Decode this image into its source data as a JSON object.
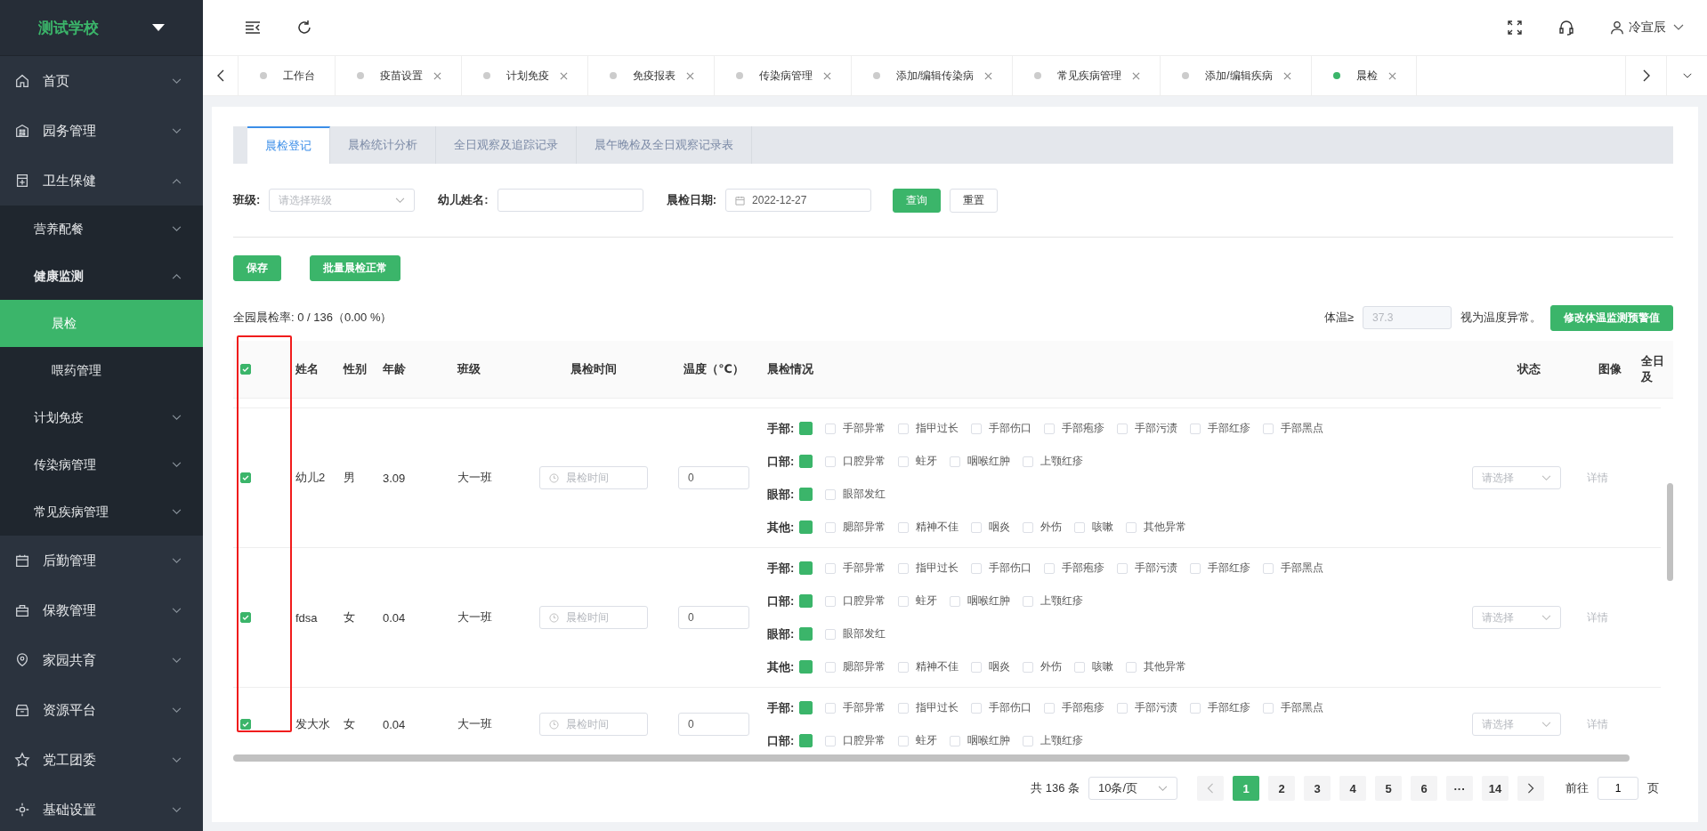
{
  "sidebar": {
    "school": "测试学校",
    "items": [
      {
        "label": "首页",
        "expanded": false
      },
      {
        "label": "园务管理",
        "expanded": false
      },
      {
        "label": "卫生保健",
        "expanded": true,
        "children": [
          {
            "label": "营养配餐",
            "expanded": false
          },
          {
            "label": "健康监测",
            "expanded": true,
            "children": [
              {
                "label": "晨检",
                "selected": true
              },
              {
                "label": "喂药管理",
                "selected": false
              }
            ]
          },
          {
            "label": "计划免疫",
            "expanded": false
          },
          {
            "label": "传染病管理",
            "expanded": false
          },
          {
            "label": "常见疾病管理",
            "expanded": false
          }
        ]
      },
      {
        "label": "后勤管理",
        "expanded": false
      },
      {
        "label": "保教管理",
        "expanded": false
      },
      {
        "label": "家园共育",
        "expanded": false
      },
      {
        "label": "资源平台",
        "expanded": false
      },
      {
        "label": "党工团委",
        "expanded": false
      },
      {
        "label": "基础设置",
        "expanded": false
      }
    ]
  },
  "header": {
    "user": "冷宣辰"
  },
  "tabs": [
    {
      "label": "工作台",
      "closable": false,
      "selected": false
    },
    {
      "label": "疫苗设置",
      "closable": true,
      "selected": false
    },
    {
      "label": "计划免疫",
      "closable": true,
      "selected": false
    },
    {
      "label": "免疫报表",
      "closable": true,
      "selected": false
    },
    {
      "label": "传染病管理",
      "closable": true,
      "selected": false
    },
    {
      "label": "添加/编辑传染病",
      "closable": true,
      "selected": false
    },
    {
      "label": "常见疾病管理",
      "closable": true,
      "selected": false
    },
    {
      "label": "添加/编辑疾病",
      "closable": true,
      "selected": false
    },
    {
      "label": "晨检",
      "closable": true,
      "selected": true
    }
  ],
  "subtabs": [
    {
      "label": "晨检登记",
      "selected": true
    },
    {
      "label": "晨检统计分析",
      "selected": false
    },
    {
      "label": "全日观察及追踪记录",
      "selected": false
    },
    {
      "label": "晨午晚检及全日观察记录表",
      "selected": false
    }
  ],
  "filters": {
    "class_label": "班级:",
    "class_placeholder": "请选择班级",
    "name_label": "幼儿姓名:",
    "date_label": "晨检日期:",
    "date_value": "2022-12-27",
    "query": "查询",
    "reset": "重置"
  },
  "actions": [
    "保存",
    "批量晨检正常"
  ],
  "rate": "全园晨检率: 0 / 136（0.00 %）",
  "threshold": {
    "label": "体温≥",
    "value": "37.3",
    "suffix": "视为温度异常。",
    "button": "修改体温监测预警值"
  },
  "table": {
    "select_all_checked": true,
    "columns": [
      "姓名",
      "性别",
      "年龄",
      "班级",
      "晨检时间",
      "温度（℃）",
      "晨检情况",
      "状态",
      "图像",
      "全日及"
    ],
    "rows": [
      {
        "checked": true,
        "name": "幼儿2",
        "gender": "男",
        "age": "3.09",
        "class": "大一班",
        "time_placeholder": "晨检时间",
        "temperature": "0",
        "status_placeholder": "请选择",
        "detail": "详情",
        "groups": [
          {
            "label": "手部:",
            "normal": true,
            "items": [
              {
                "label": "手部异常",
                "checked": false
              },
              {
                "label": "指甲过长",
                "checked": false
              },
              {
                "label": "手部伤口",
                "checked": false
              },
              {
                "label": "手部疱疹",
                "checked": false
              },
              {
                "label": "手部污渍",
                "checked": false
              },
              {
                "label": "手部红疹",
                "checked": false
              },
              {
                "label": "手部黑点",
                "checked": false
              }
            ]
          },
          {
            "label": "口部:",
            "normal": true,
            "items": [
              {
                "label": "口腔异常",
                "checked": false
              },
              {
                "label": "蛀牙",
                "checked": false
              },
              {
                "label": "咽喉红肿",
                "checked": false
              },
              {
                "label": "上颚红疹",
                "checked": false
              }
            ]
          },
          {
            "label": "眼部:",
            "normal": true,
            "items": [
              {
                "label": "眼部发红",
                "checked": false
              }
            ]
          },
          {
            "label": "其他:",
            "normal": true,
            "items": [
              {
                "label": "腮部异常",
                "checked": false
              },
              {
                "label": "精神不佳",
                "checked": false
              },
              {
                "label": "咽炎",
                "checked": false
              },
              {
                "label": "外伤",
                "checked": false
              },
              {
                "label": "咳嗽",
                "checked": false
              },
              {
                "label": "其他异常",
                "checked": false
              }
            ]
          }
        ]
      },
      {
        "checked": true,
        "name": "fdsa",
        "gender": "女",
        "age": "0.04",
        "class": "大一班",
        "time_placeholder": "晨检时间",
        "temperature": "0",
        "status_placeholder": "请选择",
        "detail": "详情",
        "groups": [
          {
            "label": "手部:",
            "normal": true,
            "items": [
              {
                "label": "手部异常",
                "checked": false
              },
              {
                "label": "指甲过长",
                "checked": false
              },
              {
                "label": "手部伤口",
                "checked": false
              },
              {
                "label": "手部疱疹",
                "checked": false
              },
              {
                "label": "手部污渍",
                "checked": false
              },
              {
                "label": "手部红疹",
                "checked": false
              },
              {
                "label": "手部黑点",
                "checked": false
              }
            ]
          },
          {
            "label": "口部:",
            "normal": true,
            "items": [
              {
                "label": "口腔异常",
                "checked": false
              },
              {
                "label": "蛀牙",
                "checked": false
              },
              {
                "label": "咽喉红肿",
                "checked": false
              },
              {
                "label": "上颚红疹",
                "checked": false
              }
            ]
          },
          {
            "label": "眼部:",
            "normal": true,
            "items": [
              {
                "label": "眼部发红",
                "checked": false
              }
            ]
          },
          {
            "label": "其他:",
            "normal": true,
            "items": [
              {
                "label": "腮部异常",
                "checked": false
              },
              {
                "label": "精神不佳",
                "checked": false
              },
              {
                "label": "咽炎",
                "checked": false
              },
              {
                "label": "外伤",
                "checked": false
              },
              {
                "label": "咳嗽",
                "checked": false
              },
              {
                "label": "其他异常",
                "checked": false
              }
            ]
          }
        ]
      },
      {
        "checked": true,
        "name": "发大水",
        "gender": "女",
        "age": "0.04",
        "class": "大一班",
        "time_placeholder": "晨检时间",
        "temperature": "0",
        "status_placeholder": "请选择",
        "detail": "详情",
        "groups": [
          {
            "label": "手部:",
            "normal": true,
            "items": [
              {
                "label": "手部异常",
                "checked": false
              },
              {
                "label": "指甲过长",
                "checked": false
              },
              {
                "label": "手部伤口",
                "checked": false
              },
              {
                "label": "手部疱疹",
                "checked": false
              },
              {
                "label": "手部污渍",
                "checked": false
              },
              {
                "label": "手部红疹",
                "checked": false
              },
              {
                "label": "手部黑点",
                "checked": false
              }
            ]
          },
          {
            "label": "口部:",
            "normal": true,
            "items": [
              {
                "label": "口腔异常",
                "checked": false
              },
              {
                "label": "蛀牙",
                "checked": false
              },
              {
                "label": "咽喉红肿",
                "checked": false
              },
              {
                "label": "上颚红疹",
                "checked": false
              }
            ]
          }
        ]
      }
    ]
  },
  "pagination": {
    "total": "共 136 条",
    "size": "10条/页",
    "pages": [
      {
        "label": "1",
        "selected": true
      },
      {
        "label": "2",
        "selected": false
      },
      {
        "label": "3",
        "selected": false
      },
      {
        "label": "4",
        "selected": false
      },
      {
        "label": "5",
        "selected": false
      },
      {
        "label": "6",
        "selected": false
      },
      {
        "label": "···",
        "selected": false
      },
      {
        "label": "14",
        "selected": false
      }
    ],
    "goto": "前往",
    "goto_value": "1",
    "page_unit": "页"
  }
}
